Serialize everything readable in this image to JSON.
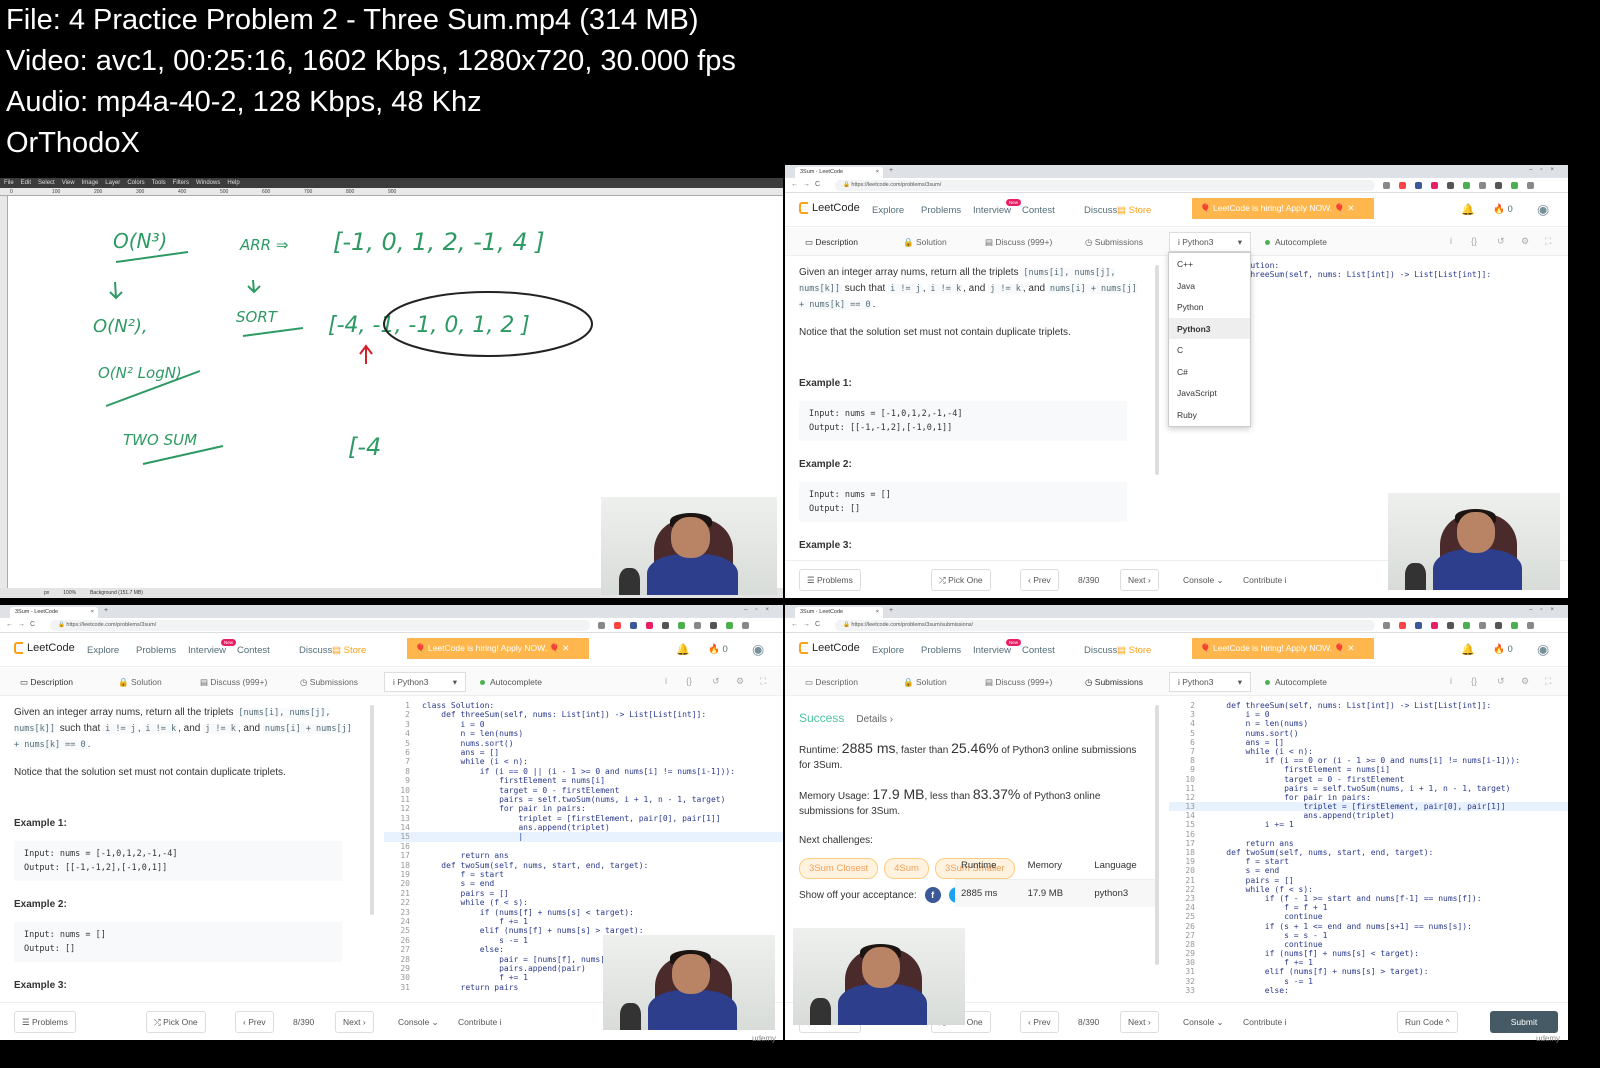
{
  "header": {
    "file": "File: 4  Practice Problem 2 - Three Sum.mp4 (314 MB)",
    "video": "Video: avc1, 00:25:16, 1602 Kbps, 1280x720, 30.000 fps",
    "audio": "Audio: mp4a-40-2, 128 Kbps, 48 Khz",
    "author": "OrThodoX"
  },
  "gimp": {
    "menu": [
      "File",
      "Edit",
      "Select",
      "View",
      "Image",
      "Layer",
      "Colors",
      "Tools",
      "Filters",
      "Windows",
      "Help"
    ],
    "ruler": [
      "0",
      "100",
      "200",
      "300",
      "400",
      "500",
      "600",
      "700",
      "800",
      "900"
    ],
    "status": [
      "px",
      "100%",
      "Background (151.7 MB)"
    ],
    "ink_color": "#2e9a63",
    "arrow_color": "#d0202a",
    "handwriting": [
      "O(N³)",
      "ARR ⇒",
      "[-1, 0, 1, 2, -1, 4 ]",
      "SORT",
      "[-4, -1, -1, 0, 1, 2 ]",
      "O(N²),",
      "O(N² LogN)",
      "TWO SUM",
      "[-4"
    ]
  },
  "colors": {
    "accent": "#ffa116",
    "banner": "#ffb74d",
    "success": "#4fc3a1",
    "submit": "#455a64",
    "new_badge": "#e91e63"
  },
  "common": {
    "tab_title": "3Sum - LeetCode",
    "nav": {
      "logo": "LeetCode",
      "explore": "Explore",
      "problems": "Problems",
      "interview": "Interview",
      "new": "New",
      "contest": "Contest",
      "discuss": "Discuss",
      "store": "Store",
      "banner": "🎈 LeetCode is hiring! Apply NOW. 🎈  ✕",
      "notifications": "0"
    },
    "tabs": [
      "Description",
      "Solution",
      "Discuss (999+)",
      "Submissions"
    ],
    "language": "Python3",
    "autocomplete": "Autocomplete",
    "footer": {
      "problems": "☰ Problems",
      "pick_one": "⤮ Pick One",
      "prev": "‹ Prev",
      "count": "8/390",
      "next": "Next ›",
      "console": "Console ⌄",
      "contribute": "Contribute i",
      "run_code": "Run Code ^",
      "submit": "Submit"
    },
    "description": {
      "p1a": "Given an integer array nums, return all the triplets ",
      "p1code1": "[nums[i], nums[j], nums[k]]",
      "p1b": " such that ",
      "p1code2": "i != j",
      "p1c": ", ",
      "p1code3": "i != k",
      "p1d": ", and ",
      "p1code4": "j != k",
      "p1e": ", and ",
      "p1code5": "nums[i] + nums[j] + nums[k] == 0",
      "p1f": ".",
      "p2": "Notice that the solution set must not contain duplicate triplets.",
      "ex1": "Example 1:",
      "ex1_input": "Input: nums = [-1,0,1,2,-1,-4]",
      "ex1_output": "Output: [[-1,-1,2],[-1,0,1]]",
      "ex2": "Example 2:",
      "ex2_input": "Input: nums = []",
      "ex2_output": "Output: []",
      "ex3": "Example 3:"
    }
  },
  "panels": {
    "top_right": {
      "url": "https://leetcode.com/problems/3sum/",
      "active_tab": 0,
      "dropdown": [
        "C++",
        "Java",
        "Python",
        "Python3",
        "C",
        "C#",
        "JavaScript",
        "Ruby"
      ],
      "dropdown_selected": "Python3",
      "code_start": 1,
      "code": [
        "class Solution:",
        "    def threeSum(self, nums: List[int]) -> List[List[int]]:"
      ]
    },
    "bottom_left": {
      "url": "https://leetcode.com/problems/3sum/",
      "active_tab": 0,
      "code_start": 1,
      "highlight_line": 15,
      "code": [
        "class Solution:",
        "    def threeSum(self, nums: List[int]) -> List[List[int]]:",
        "        i = 0",
        "        n = len(nums)",
        "        nums.sort()",
        "        ans = []",
        "        while (i < n):",
        "            if (i == 0 || (i - 1 >= 0 and nums[i] != nums[i-1])):",
        "                firstElement = nums[i]",
        "                target = 0 - firstElement",
        "                pairs = self.twoSum(nums, i + 1, n - 1, target)",
        "                for pair in pairs:",
        "                    triplet = [firstElement, pair[0], pair[1]]",
        "                    ans.append(triplet)",
        "                    |",
        "",
        "        return ans",
        "    def twoSum(self, nums, start, end, target):",
        "        f = start",
        "        s = end",
        "        pairs = []",
        "        while (f < s):",
        "            if (nums[f] + nums[s] < target):",
        "                f += 1",
        "            elif (nums[f] + nums[s] > target):",
        "                s -= 1",
        "            else:",
        "                pair = [nums[f], nums[s]]",
        "                pairs.append(pair)",
        "                f += 1",
        "        return pairs"
      ]
    },
    "bottom_right": {
      "url": "https://leetcode.com/problems/3sum/submissions/",
      "active_tab": 3,
      "code_start": 2,
      "highlight_line": 13,
      "code": [
        "    def threeSum(self, nums: List[int]) -> List[List[int]]:",
        "        i = 0",
        "        n = len(nums)",
        "        nums.sort()",
        "        ans = []",
        "        while (i < n):",
        "            if (i == 0 or (i - 1 >= 0 and nums[i] != nums[i-1])):",
        "                firstElement = nums[i]",
        "                target = 0 - firstElement",
        "                pairs = self.twoSum(nums, i + 1, n - 1, target)",
        "                for pair in pairs:",
        "                    triplet = [firstElement, pair[0], pair[1]]",
        "                    ans.append(triplet)",
        "            i += 1",
        "",
        "        return ans",
        "    def twoSum(self, nums, start, end, target):",
        "        f = start",
        "        s = end",
        "        pairs = []",
        "        while (f < s):",
        "            if (f - 1 >= start and nums[f-1] == nums[f]):",
        "                f = f + 1",
        "                continue",
        "            if (s + 1 <= end and nums[s+1] == nums[s]):",
        "                s = s - 1",
        "                continue",
        "            if (nums[f] + nums[s] < target):",
        "                f += 1",
        "            elif (nums[f] + nums[s] > target):",
        "                s -= 1",
        "            else:"
      ],
      "submission": {
        "status": "Success",
        "details": "Details ›",
        "runtime_label": "Runtime: ",
        "runtime": "2885 ms",
        "faster": ", faster than ",
        "runtime_pct": "25.46%",
        "runtime_tail": " of Python3 online submissions for 3Sum.",
        "memory_label": "Memory Usage: ",
        "memory": "17.9 MB",
        "less": ", less than ",
        "memory_pct": "83.37%",
        "memory_tail": " of Python3 online submissions for 3Sum.",
        "next_label": "Next challenges:",
        "challenges": [
          "3Sum Closest",
          "4Sum",
          "3Sum Smaller"
        ],
        "share_label": "Show off your acceptance:",
        "table_headers": [
          "Runtime",
          "Memory",
          "Language"
        ],
        "table_row": [
          "2885 ms",
          "17.9 MB",
          "python3"
        ]
      }
    }
  },
  "watermark": "udemy"
}
